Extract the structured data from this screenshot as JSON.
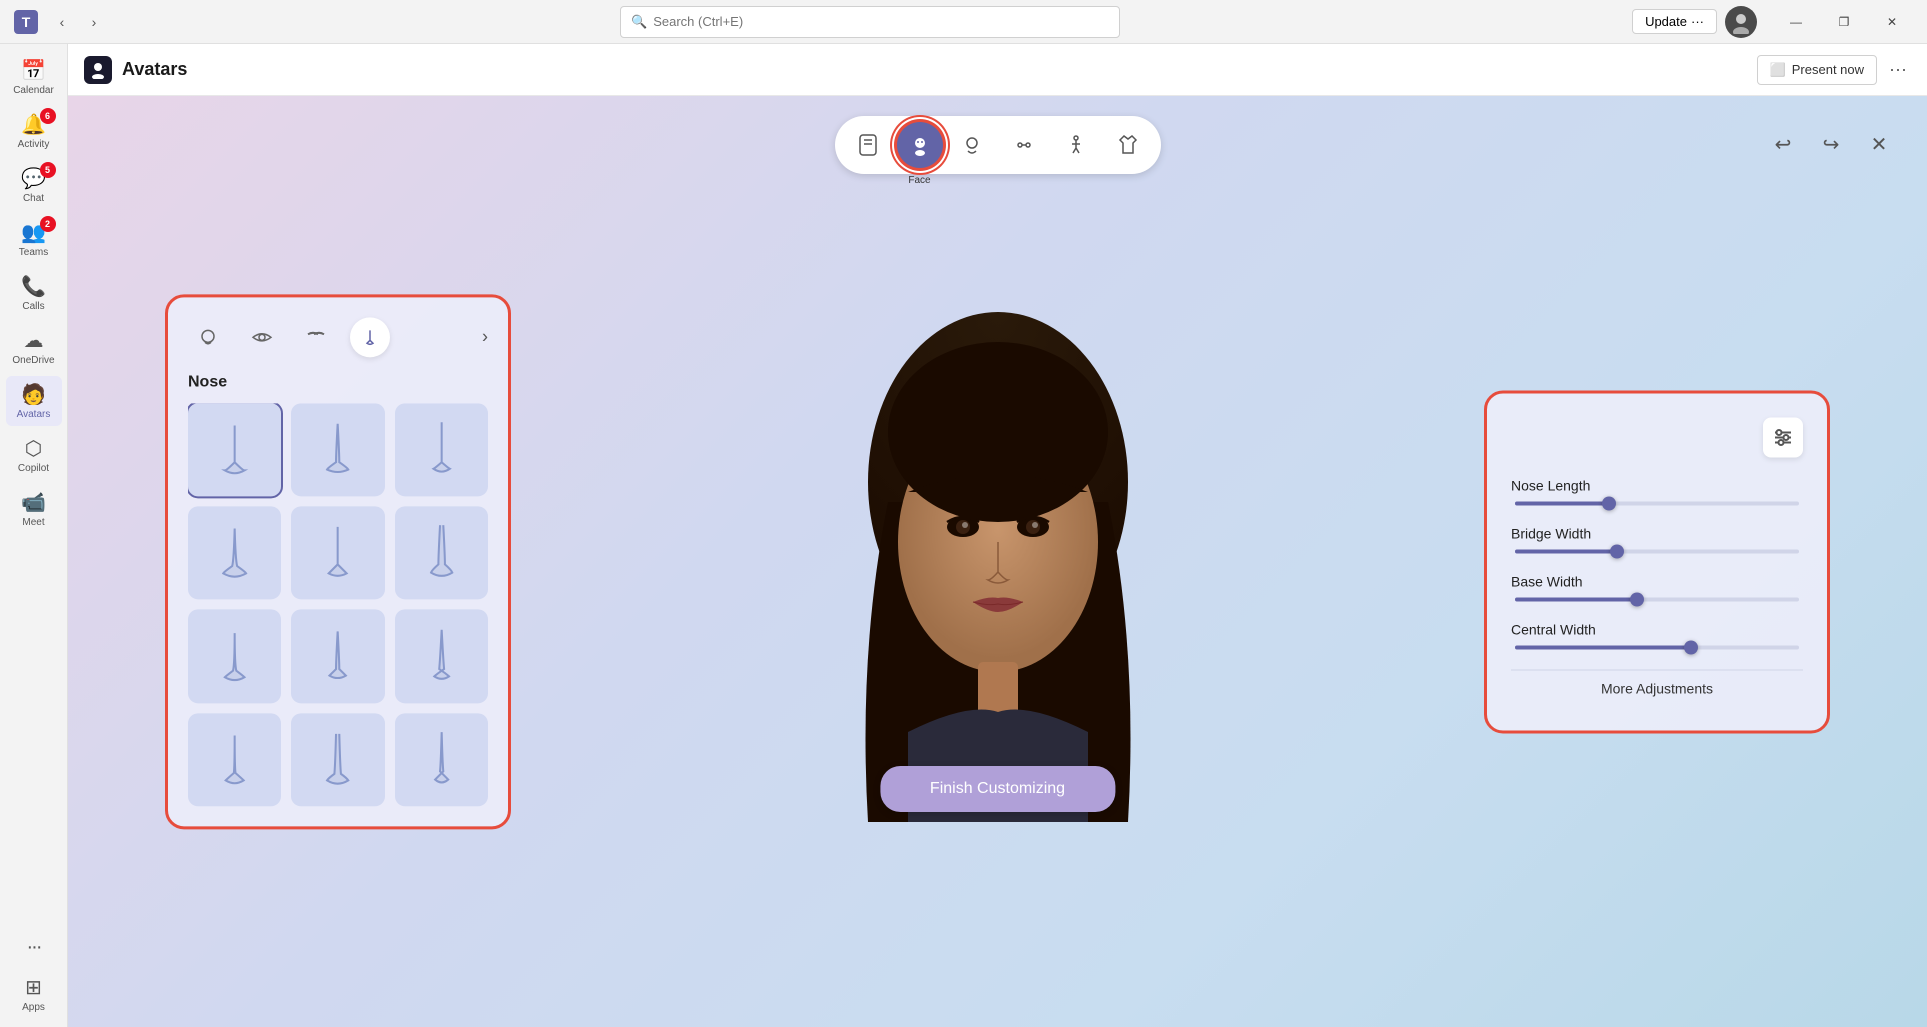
{
  "titleBar": {
    "appName": "Microsoft Teams",
    "searchPlaceholder": "Search (Ctrl+E)",
    "updateLabel": "Update",
    "windowControls": {
      "minimize": "—",
      "maximize": "❐",
      "close": "✕"
    }
  },
  "sidebar": {
    "items": [
      {
        "id": "calendar",
        "label": "Calendar",
        "icon": "📅",
        "badge": null,
        "active": false
      },
      {
        "id": "activity",
        "label": "Activity",
        "icon": "🔔",
        "badge": "6",
        "active": false
      },
      {
        "id": "chat",
        "label": "Chat",
        "icon": "💬",
        "badge": "5",
        "active": false
      },
      {
        "id": "teams",
        "label": "Teams",
        "icon": "👥",
        "badge": "2",
        "active": false
      },
      {
        "id": "calls",
        "label": "Calls",
        "icon": "📞",
        "badge": null,
        "active": false
      },
      {
        "id": "onedrive",
        "label": "OneDrive",
        "icon": "☁",
        "badge": null,
        "active": false
      },
      {
        "id": "avatars",
        "label": "Avatars",
        "icon": "🧑",
        "badge": null,
        "active": true
      },
      {
        "id": "copilot",
        "label": "Copilot",
        "icon": "⬡",
        "badge": null,
        "active": false
      },
      {
        "id": "meet",
        "label": "Meet",
        "icon": "📹",
        "badge": null,
        "active": false
      },
      {
        "id": "more",
        "label": "...",
        "icon": "···",
        "badge": null,
        "active": false
      },
      {
        "id": "apps",
        "label": "Apps",
        "icon": "⊞",
        "badge": null,
        "active": false
      }
    ]
  },
  "header": {
    "appIconColor": "#1a1a2e",
    "title": "Avatars",
    "presentNowLabel": "Present now",
    "moreOptions": "···"
  },
  "toolbar": {
    "tabs": [
      {
        "id": "body",
        "icon": "🖼",
        "label": null,
        "active": false
      },
      {
        "id": "face",
        "icon": "😶",
        "label": "Face",
        "active": true
      },
      {
        "id": "head",
        "icon": "🤔",
        "label": null,
        "active": false
      },
      {
        "id": "body2",
        "icon": "👔",
        "label": null,
        "active": false
      },
      {
        "id": "pose",
        "icon": "🤸",
        "label": null,
        "active": false
      },
      {
        "id": "outfit",
        "icon": "👕",
        "label": null,
        "active": false
      }
    ],
    "controls": {
      "undo": "↩",
      "redo": "↪",
      "close": "✕"
    }
  },
  "leftPanel": {
    "tabs": [
      {
        "id": "face-shape",
        "icon": "😊",
        "active": false
      },
      {
        "id": "eyes",
        "icon": "👁",
        "active": false
      },
      {
        "id": "eyebrows",
        "icon": "〰",
        "active": false
      },
      {
        "id": "nose",
        "icon": "〰",
        "active": true
      }
    ],
    "sectionTitle": "Nose",
    "noseItems": [
      {
        "id": 1
      },
      {
        "id": 2
      },
      {
        "id": 3
      },
      {
        "id": 4
      },
      {
        "id": 5
      },
      {
        "id": 6
      },
      {
        "id": 7
      },
      {
        "id": 8
      },
      {
        "id": 9
      },
      {
        "id": 10
      },
      {
        "id": 11
      },
      {
        "id": 12
      }
    ]
  },
  "rightPanel": {
    "sliders": [
      {
        "id": "nose-length",
        "label": "Nose Length",
        "value": 33
      },
      {
        "id": "bridge-width",
        "label": "Bridge Width",
        "value": 36
      },
      {
        "id": "base-width",
        "label": "Base Width",
        "value": 43
      },
      {
        "id": "central-width",
        "label": "Central Width",
        "value": 62
      }
    ],
    "moreAdjustmentsLabel": "More Adjustments"
  },
  "finishButton": {
    "label": "Finish Customizing"
  }
}
